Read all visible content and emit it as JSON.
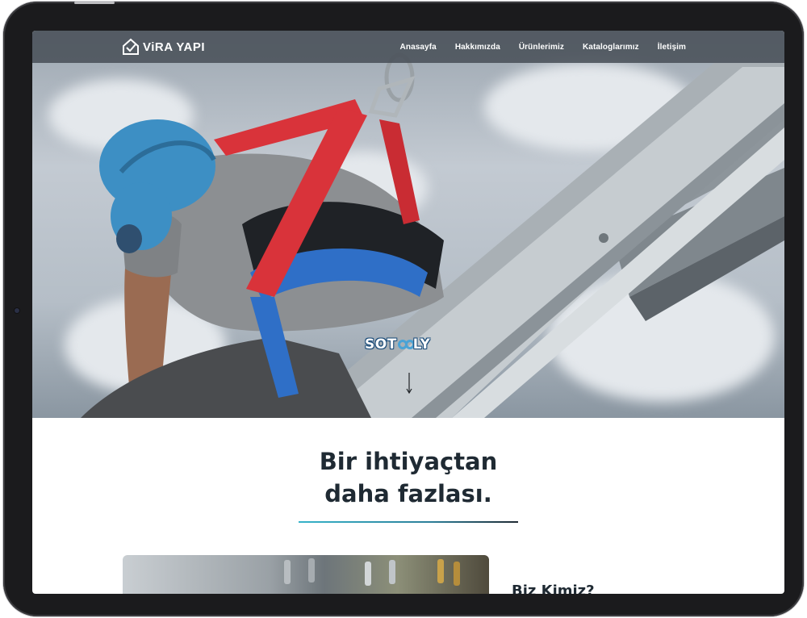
{
  "site": {
    "logo_text": "ViRA YAPI",
    "logo_icon": "house-check-icon"
  },
  "nav": {
    "items": [
      "Anasayfa",
      "Hakkımızda",
      "Ürünlerimiz",
      "Kataloglarımız",
      "İletişim"
    ]
  },
  "hero": {
    "brand_left": "SOT",
    "brand_right": "LY",
    "scroll_icon": "arrow-down-icon"
  },
  "intro": {
    "headline_line1": "Bir ihtiyaçtan",
    "headline_line2": "daha fazlası.",
    "section_title": "Biz Kimiz?"
  },
  "colors": {
    "accent": "#36b3c9",
    "text_dark": "#1f2a33",
    "navbar": "#464e56",
    "helmet": "#3d8fc4",
    "harness_red": "#d9333a",
    "harness_blue": "#2f6fc7"
  }
}
